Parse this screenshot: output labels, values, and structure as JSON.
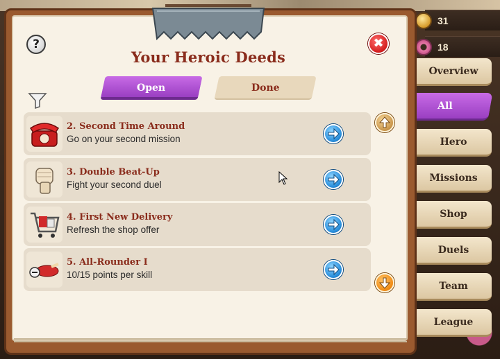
{
  "header": {
    "title": "Your Heroic Deeds",
    "help_label": "?",
    "close_label": "✖"
  },
  "counters": [
    {
      "value": "31",
      "icon": "coin-icon"
    },
    {
      "value": "18",
      "icon": "donut-icon"
    }
  ],
  "tabs": {
    "open_label": "Open",
    "done_label": "Done",
    "active": "Open"
  },
  "deeds": [
    {
      "title": "2. Second Time Around",
      "description": "Go on your second mission",
      "icon": "red-telephone-icon"
    },
    {
      "title": "3. Double Beat-Up",
      "description": "Fight your second duel",
      "icon": "fist-icon"
    },
    {
      "title": "4. First New Delivery",
      "description": "Refresh the shop offer",
      "icon": "shopping-cart-icon"
    },
    {
      "title": "5. All-Rounder I",
      "description": "10/15 points per skill",
      "icon": "hero-lying-icon"
    }
  ],
  "sidebar": {
    "items": [
      {
        "label": "Overview"
      },
      {
        "label": "All",
        "active": true
      },
      {
        "label": "Hero"
      },
      {
        "label": "Missions"
      },
      {
        "label": "Shop"
      },
      {
        "label": "Duels"
      },
      {
        "label": "Team"
      },
      {
        "label": "League"
      }
    ]
  },
  "colors": {
    "accent_purple": "#9a3fc2",
    "title_red": "#8a2c1c",
    "paper": "#f8f2e6",
    "frame": "#9a5a2f"
  }
}
